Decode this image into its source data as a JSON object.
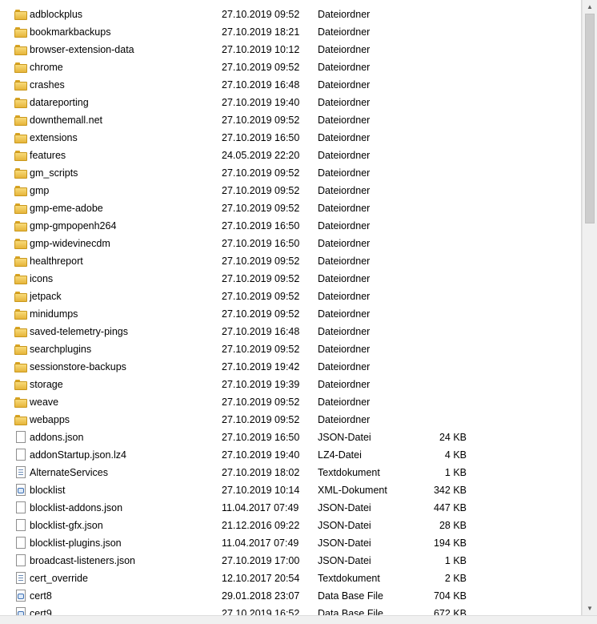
{
  "files": [
    {
      "name": "adblockplus",
      "date": "27.10.2019 09:52",
      "type": "Dateiordner",
      "size": "",
      "icon": "folder"
    },
    {
      "name": "bookmarkbackups",
      "date": "27.10.2019 18:21",
      "type": "Dateiordner",
      "size": "",
      "icon": "folder"
    },
    {
      "name": "browser-extension-data",
      "date": "27.10.2019 10:12",
      "type": "Dateiordner",
      "size": "",
      "icon": "folder"
    },
    {
      "name": "chrome",
      "date": "27.10.2019 09:52",
      "type": "Dateiordner",
      "size": "",
      "icon": "folder"
    },
    {
      "name": "crashes",
      "date": "27.10.2019 16:48",
      "type": "Dateiordner",
      "size": "",
      "icon": "folder"
    },
    {
      "name": "datareporting",
      "date": "27.10.2019 19:40",
      "type": "Dateiordner",
      "size": "",
      "icon": "folder"
    },
    {
      "name": "downthemall.net",
      "date": "27.10.2019 09:52",
      "type": "Dateiordner",
      "size": "",
      "icon": "folder"
    },
    {
      "name": "extensions",
      "date": "27.10.2019 16:50",
      "type": "Dateiordner",
      "size": "",
      "icon": "folder"
    },
    {
      "name": "features",
      "date": "24.05.2019 22:20",
      "type": "Dateiordner",
      "size": "",
      "icon": "folder"
    },
    {
      "name": "gm_scripts",
      "date": "27.10.2019 09:52",
      "type": "Dateiordner",
      "size": "",
      "icon": "folder"
    },
    {
      "name": "gmp",
      "date": "27.10.2019 09:52",
      "type": "Dateiordner",
      "size": "",
      "icon": "folder"
    },
    {
      "name": "gmp-eme-adobe",
      "date": "27.10.2019 09:52",
      "type": "Dateiordner",
      "size": "",
      "icon": "folder"
    },
    {
      "name": "gmp-gmpopenh264",
      "date": "27.10.2019 16:50",
      "type": "Dateiordner",
      "size": "",
      "icon": "folder"
    },
    {
      "name": "gmp-widevinecdm",
      "date": "27.10.2019 16:50",
      "type": "Dateiordner",
      "size": "",
      "icon": "folder"
    },
    {
      "name": "healthreport",
      "date": "27.10.2019 09:52",
      "type": "Dateiordner",
      "size": "",
      "icon": "folder"
    },
    {
      "name": "icons",
      "date": "27.10.2019 09:52",
      "type": "Dateiordner",
      "size": "",
      "icon": "folder"
    },
    {
      "name": "jetpack",
      "date": "27.10.2019 09:52",
      "type": "Dateiordner",
      "size": "",
      "icon": "folder"
    },
    {
      "name": "minidumps",
      "date": "27.10.2019 09:52",
      "type": "Dateiordner",
      "size": "",
      "icon": "folder"
    },
    {
      "name": "saved-telemetry-pings",
      "date": "27.10.2019 16:48",
      "type": "Dateiordner",
      "size": "",
      "icon": "folder"
    },
    {
      "name": "searchplugins",
      "date": "27.10.2019 09:52",
      "type": "Dateiordner",
      "size": "",
      "icon": "folder"
    },
    {
      "name": "sessionstore-backups",
      "date": "27.10.2019 19:42",
      "type": "Dateiordner",
      "size": "",
      "icon": "folder"
    },
    {
      "name": "storage",
      "date": "27.10.2019 19:39",
      "type": "Dateiordner",
      "size": "",
      "icon": "folder"
    },
    {
      "name": "weave",
      "date": "27.10.2019 09:52",
      "type": "Dateiordner",
      "size": "",
      "icon": "folder"
    },
    {
      "name": "webapps",
      "date": "27.10.2019 09:52",
      "type": "Dateiordner",
      "size": "",
      "icon": "folder"
    },
    {
      "name": "addons.json",
      "date": "27.10.2019 16:50",
      "type": "JSON-Datei",
      "size": "24 KB",
      "icon": "file"
    },
    {
      "name": "addonStartup.json.lz4",
      "date": "27.10.2019 19:40",
      "type": "LZ4-Datei",
      "size": "4 KB",
      "icon": "file"
    },
    {
      "name": "AlternateServices",
      "date": "27.10.2019 18:02",
      "type": "Textdokument",
      "size": "1 KB",
      "icon": "text"
    },
    {
      "name": "blocklist",
      "date": "27.10.2019 10:14",
      "type": "XML-Dokument",
      "size": "342 KB",
      "icon": "xml"
    },
    {
      "name": "blocklist-addons.json",
      "date": "11.04.2017 07:49",
      "type": "JSON-Datei",
      "size": "447 KB",
      "icon": "file"
    },
    {
      "name": "blocklist-gfx.json",
      "date": "21.12.2016 09:22",
      "type": "JSON-Datei",
      "size": "28 KB",
      "icon": "file"
    },
    {
      "name": "blocklist-plugins.json",
      "date": "11.04.2017 07:49",
      "type": "JSON-Datei",
      "size": "194 KB",
      "icon": "file"
    },
    {
      "name": "broadcast-listeners.json",
      "date": "27.10.2019 17:00",
      "type": "JSON-Datei",
      "size": "1 KB",
      "icon": "file"
    },
    {
      "name": "cert_override",
      "date": "12.10.2017 20:54",
      "type": "Textdokument",
      "size": "2 KB",
      "icon": "text"
    },
    {
      "name": "cert8",
      "date": "29.01.2018 23:07",
      "type": "Data Base File",
      "size": "704 KB",
      "icon": "db"
    },
    {
      "name": "cert9",
      "date": "27.10.2019 16:52",
      "type": "Data Base File",
      "size": "672 KB",
      "icon": "db"
    }
  ],
  "scrollbar": {
    "up_glyph": "▲",
    "down_glyph": "▼"
  }
}
